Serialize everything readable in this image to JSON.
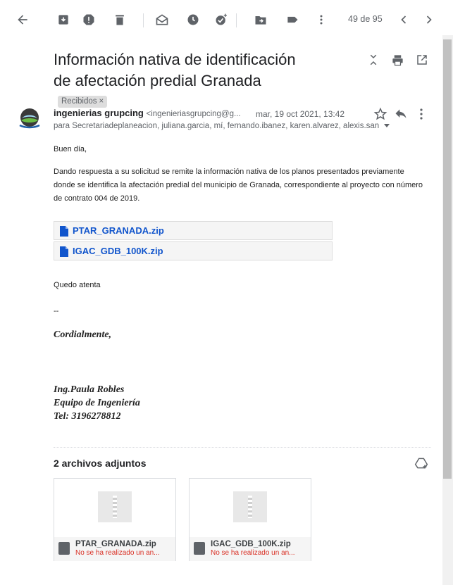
{
  "toolbar": {
    "back": "arrow-back-icon",
    "page_counter": "49 de 95"
  },
  "message": {
    "subject": "Información nativa de identificación de afectación predial Granada",
    "label": "Recibidos",
    "label_close": "×"
  },
  "sender": {
    "name": "ingenierias grupcing",
    "email": "<ingenieriasgrupcing@g...",
    "date": "mar, 19 oct 2021, 13:42",
    "recipients": "para Secretariadeplaneacion, juliana.garcia, mí, fernando.ibanez, karen.alvarez, alexis.san"
  },
  "body": {
    "greeting": "Buen día,",
    "paragraph": "Dando respuesta a su solicitud se remite la información nativa de los planos presentados previamente donde se identifica la afectación predial del municipio de Granada, correspondiente al proyecto con número de contrato 004 de 2019.",
    "links": [
      "PTAR_GRANADA.zip",
      "IGAC_GDB_100K.zip"
    ],
    "closing": "Quedo atenta",
    "dashes": "--"
  },
  "signature": {
    "line1": "Cordialmente,",
    "name": "Ing.Paula Robles",
    "team": "Equipo de Ingeniería",
    "tel": "Tel: 3196278812"
  },
  "attachments": {
    "count_label": "2 archivos adjuntos",
    "items": [
      {
        "name": "PTAR_GRANADA.zip",
        "status": "No se ha realizado un an..."
      },
      {
        "name": "IGAC_GDB_100K.zip",
        "status": "No se ha realizado un an..."
      }
    ]
  },
  "colors": {
    "accent": "#1155cc",
    "error": "#d93025",
    "icon": "#5f6368"
  }
}
